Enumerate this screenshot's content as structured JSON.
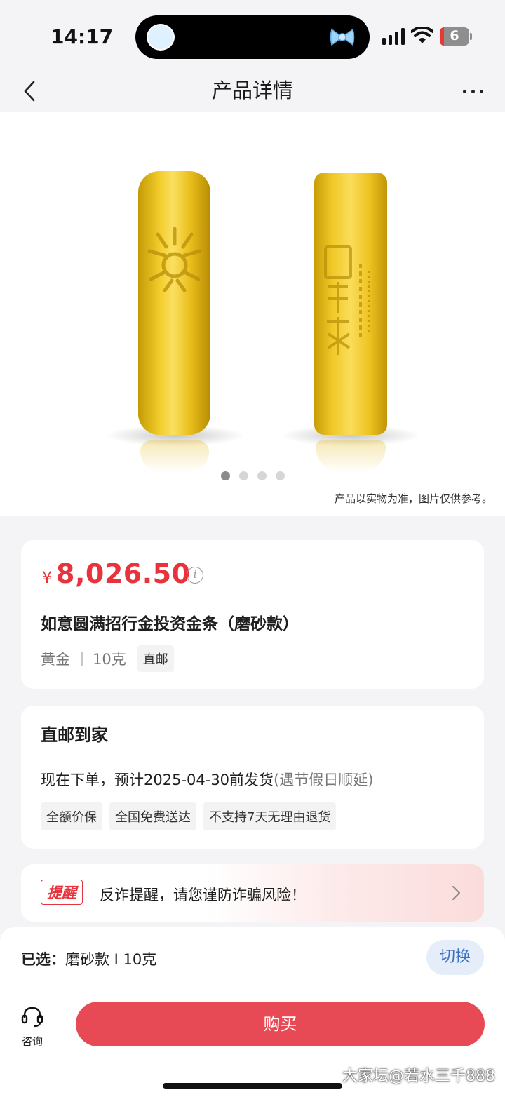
{
  "status": {
    "time": "14:17",
    "battery": "6"
  },
  "nav": {
    "title": "产品详情"
  },
  "gallery": {
    "disclaimer": "产品以实物为准，图片仅供参考。",
    "page_count": 4,
    "current_page": 1
  },
  "product": {
    "currency": "¥",
    "price": "8,026.50",
    "info_glyph": "i",
    "name": "如意圆满招行金投资金条（磨砂款）",
    "material": "黄金",
    "weight": "10克",
    "delivery_tag": "直邮"
  },
  "shipping": {
    "title": "直邮到家",
    "line": "现在下单，预计2025-04-30前发货",
    "note": "(遇节假日顺延)",
    "tags": [
      "全额价保",
      "全国免费送达",
      "不支持7天无理由退货"
    ]
  },
  "alert": {
    "badge": "提醒",
    "text": "反诈提醒，请您谨防诈骗风险！"
  },
  "selection": {
    "prefix": "已选：",
    "value": "磨砂款 I 10克",
    "switch_label": "切换"
  },
  "bottom": {
    "consult_label": "咨询",
    "buy_label": "购买"
  },
  "watermark": "大家坛@若水三千888",
  "colors": {
    "price_red": "#e8333c",
    "buy_button": "#e84a55",
    "switch_blue": "#3a6fc4",
    "gold": "#f2cd2c"
  }
}
